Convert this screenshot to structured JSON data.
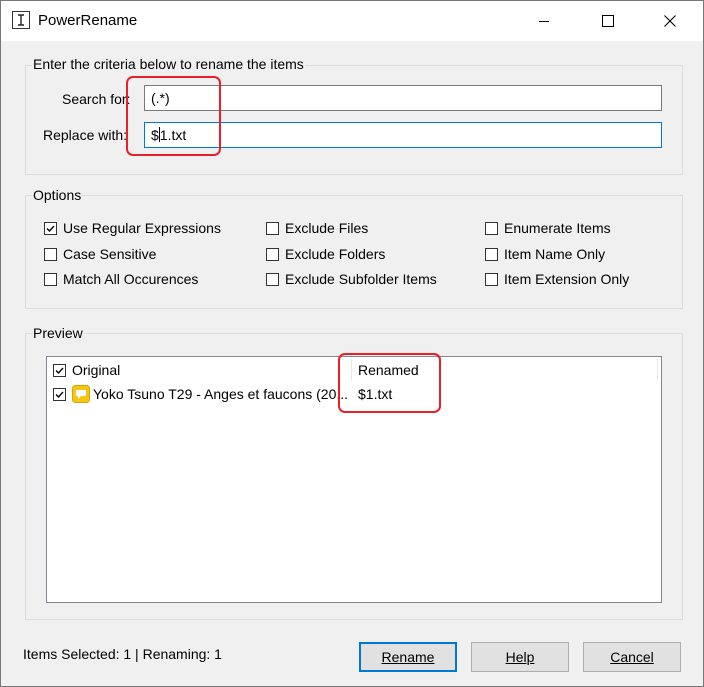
{
  "window": {
    "title": "PowerRename",
    "icon": "text-cursor-icon"
  },
  "title_controls": {
    "minimize_icon": "minimize-icon",
    "maximize_icon": "maximize-icon",
    "close_icon": "close-icon"
  },
  "criteria": {
    "group_label": "Enter the criteria below to rename the items",
    "search_label": "Search for:",
    "search_value": "(.*)",
    "replace_label": "Replace with:",
    "replace_value_before_caret": "$",
    "replace_value_after_caret": "1.txt"
  },
  "options": {
    "group_label": "Options",
    "items": [
      {
        "label": "Use Regular Expressions",
        "checked": true
      },
      {
        "label": "Case Sensitive",
        "checked": false
      },
      {
        "label": "Match All Occurences",
        "checked": false
      },
      {
        "label": "Exclude Files",
        "checked": false
      },
      {
        "label": "Exclude Folders",
        "checked": false
      },
      {
        "label": "Exclude Subfolder Items",
        "checked": false
      },
      {
        "label": "Enumerate Items",
        "checked": false
      },
      {
        "label": "Item Name Only",
        "checked": false
      },
      {
        "label": "Item Extension Only",
        "checked": false
      }
    ]
  },
  "preview": {
    "group_label": "Preview",
    "columns": {
      "original": "Original",
      "renamed": "Renamed"
    },
    "header_checked": true,
    "rows": [
      {
        "checked": true,
        "original": "Yoko Tsuno T29 - Anges et faucons (20...",
        "renamed": "$1.txt",
        "icon": "chat-bubble-icon"
      }
    ]
  },
  "status": {
    "text": "Items Selected: 1 | Renaming: 1"
  },
  "buttons": {
    "rename": "Rename",
    "help": "Help",
    "cancel": "Cancel"
  },
  "colors": {
    "accent": "#0078d7",
    "annotation": "#e8202a",
    "file_icon": "#f5c518"
  }
}
